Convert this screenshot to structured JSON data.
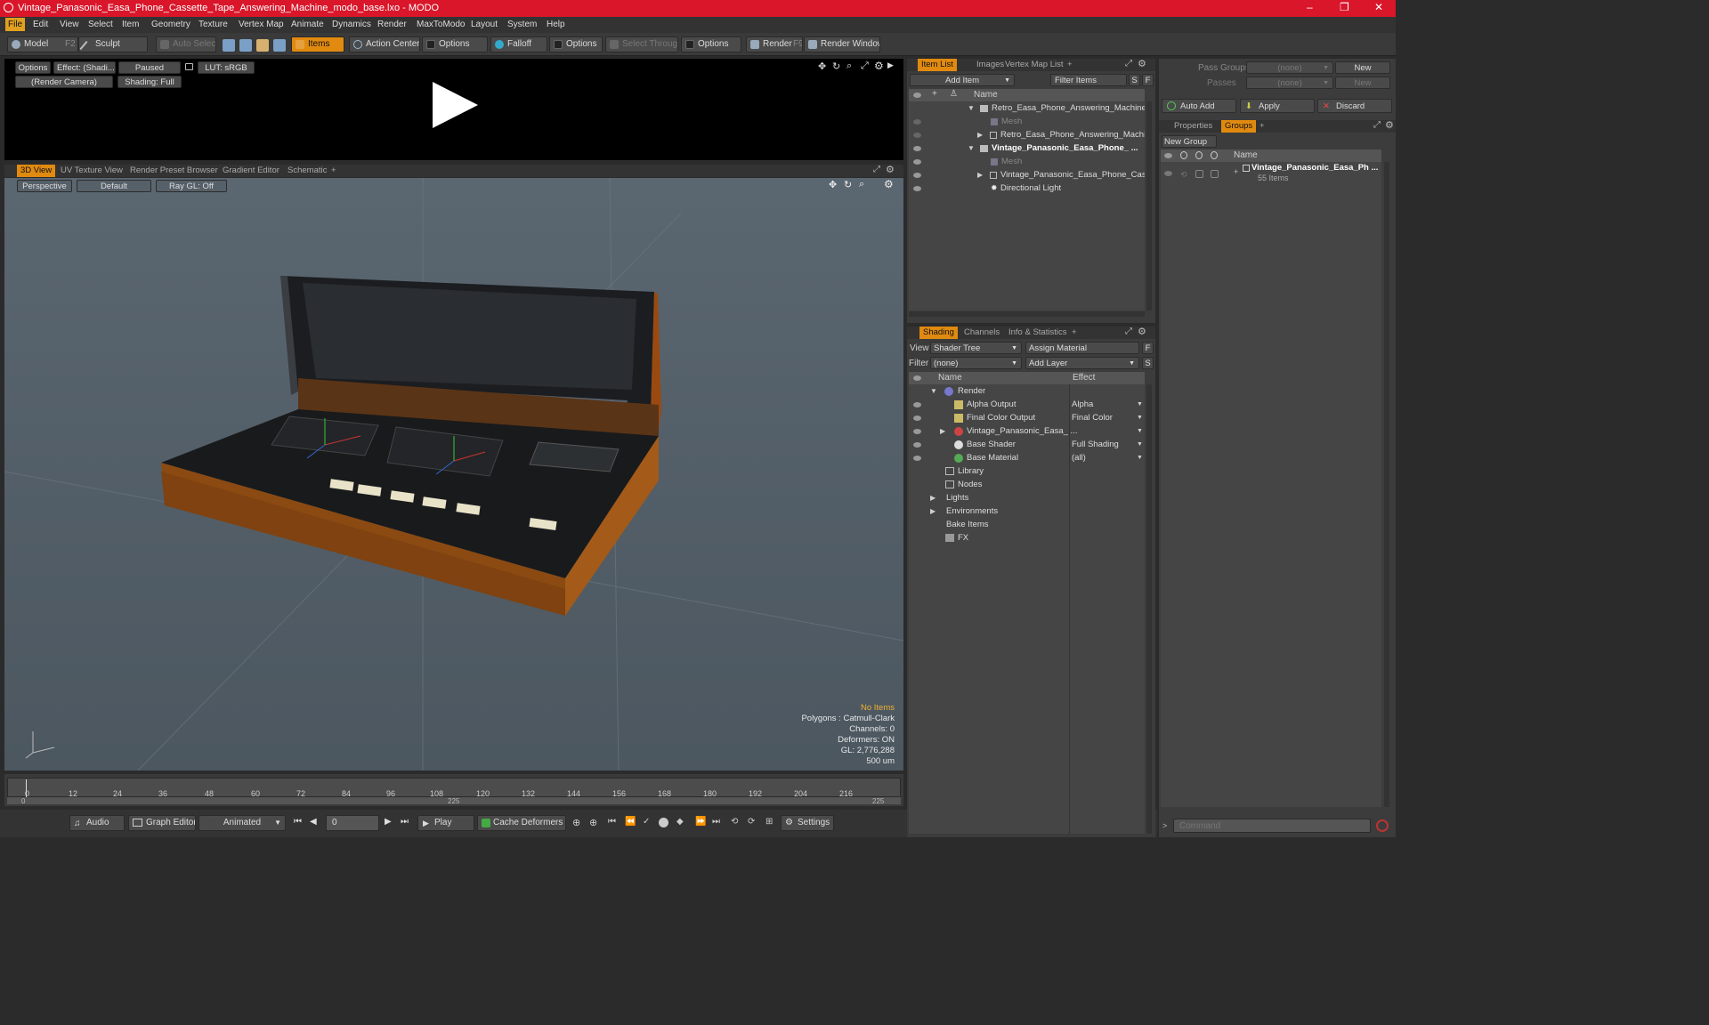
{
  "window": {
    "title": "Vintage_Panasonic_Easa_Phone_Cassette_Tape_Answering_Machine_modo_base.lxo - MODO",
    "minimize": "–",
    "maximize": "❐",
    "close": "✕"
  },
  "menu": [
    "File",
    "Edit",
    "View",
    "Select",
    "Item",
    "Geometry",
    "Texture",
    "Vertex Map",
    "Animate",
    "Dynamics",
    "Render",
    "MaxToModo",
    "Layout",
    "System",
    "Help"
  ],
  "toolbar": {
    "model": "Model",
    "model_key": "F2",
    "sculpt": "Sculpt",
    "auto_select": "Auto Select",
    "items": "Items",
    "action_center": "Action Center",
    "options1": "Options",
    "falloff": "Falloff",
    "options2": "Options",
    "select_through": "Select Through",
    "options3": "Options",
    "render": "Render",
    "render_key": "F9",
    "render_window": "Render Window"
  },
  "preview": {
    "options": "Options",
    "effect": "Effect: (Shadi...",
    "paused": "Paused",
    "lut": "LUT: sRGB",
    "camera": "(Render Camera)",
    "shading": "Shading: Full"
  },
  "view_tabs": [
    "3D View",
    "UV Texture View",
    "Render Preset Browser",
    "Gradient Editor",
    "Schematic",
    "+"
  ],
  "viewport": {
    "perspective": "Perspective",
    "default": "Default",
    "raygl": "Ray GL: Off",
    "hud_no_items": "No Items",
    "hud_polygons": "Polygons : Catmull-Clark",
    "hud_channels": "Channels: 0",
    "hud_deformers": "Deformers: ON",
    "hud_gl": "GL: 2,776,288",
    "hud_scale": "500 um"
  },
  "timeline": {
    "ticks": [
      "0",
      "12",
      "24",
      "36",
      "48",
      "60",
      "72",
      "84",
      "96",
      "108",
      "120",
      "132",
      "144",
      "156",
      "168",
      "180",
      "192",
      "204",
      "216"
    ],
    "sub_left": "0",
    "sub_mid": "225",
    "sub_right": "225"
  },
  "bottom": {
    "audio": "Audio",
    "graph_editor": "Graph Editor",
    "animated": "Animated",
    "frame": "0",
    "play": "Play",
    "cache": "Cache Deformers",
    "settings": "Settings"
  },
  "item_list": {
    "tabs": [
      "Item List",
      "Images",
      "Vertex Map List",
      "+"
    ],
    "add_item": "Add Item",
    "filter_items": "Filter Items",
    "s": "S",
    "f": "F",
    "col_name": "Name",
    "rows": [
      {
        "label": "Retro_Easa_Phone_Answering_Machine ...",
        "bold": false
      },
      {
        "label": "Mesh",
        "bold": false
      },
      {
        "label": "Retro_Easa_Phone_Answering_Machi ...",
        "bold": false
      },
      {
        "label": "Vintage_Panasonic_Easa_Phone_ ...",
        "bold": true
      },
      {
        "label": "Mesh",
        "bold": false
      },
      {
        "label": "Vintage_Panasonic_Easa_Phone_Cas ...",
        "bold": false
      },
      {
        "label": "Directional Light",
        "bold": false
      }
    ]
  },
  "shading": {
    "tabs": [
      "Shading",
      "Channels",
      "Info & Statistics",
      "+"
    ],
    "view_label": "View",
    "view_value": "Shader Tree",
    "assign_material": "Assign Material",
    "f": "F",
    "filter_label": "Filter",
    "filter_value": "(none)",
    "add_layer": "Add Layer",
    "s": "S",
    "col_name": "Name",
    "col_effect": "Effect",
    "rows": [
      {
        "name": "Render",
        "effect": ""
      },
      {
        "name": "Alpha Output",
        "effect": "Alpha"
      },
      {
        "name": "Final Color Output",
        "effect": "Final Color"
      },
      {
        "name": "Vintage_Panasonic_Easa_ ...",
        "effect": ""
      },
      {
        "name": "Base Shader",
        "effect": "Full Shading"
      },
      {
        "name": "Base Material",
        "effect": "(all)"
      },
      {
        "name": "Library",
        "effect": ""
      },
      {
        "name": "Nodes",
        "effect": ""
      },
      {
        "name": "Lights",
        "effect": ""
      },
      {
        "name": "Environments",
        "effect": ""
      },
      {
        "name": "Bake Items",
        "effect": ""
      },
      {
        "name": "FX",
        "effect": ""
      }
    ]
  },
  "groups": {
    "pass_groups": "Pass Groups",
    "pass_groups_value": "(none)",
    "new": "New",
    "passes": "Passes",
    "passes_value": "(none)",
    "new2": "New",
    "auto_add": "Auto Add",
    "apply": "Apply",
    "discard": "Discard",
    "tabs": [
      "Properties",
      "Groups",
      "+"
    ],
    "new_group": "New Group",
    "col_name": "Name",
    "group_name": "Vintage_Panasonic_Easa_Ph ...",
    "group_count": "55 Items"
  },
  "command": {
    "placeholder": "Command"
  },
  "colors": {
    "accent": "#e08a10",
    "titlebar": "#d9162a"
  }
}
